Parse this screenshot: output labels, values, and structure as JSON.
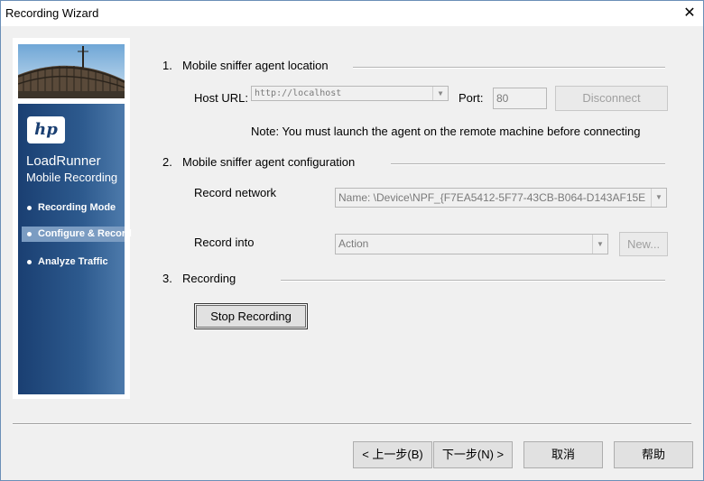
{
  "window": {
    "title": "Recording Wizard",
    "close_glyph": "✕"
  },
  "sidebar": {
    "logo_text": "hp",
    "product": "LoadRunner",
    "subproduct": "Mobile Recording",
    "items": [
      {
        "label": "Recording Mode",
        "active": false
      },
      {
        "label": "Configure & Record",
        "active": true
      },
      {
        "label": "Analyze Traffic",
        "active": false
      }
    ]
  },
  "section1": {
    "number": "1.",
    "title": "Mobile sniffer agent location",
    "host_label": "Host URL:",
    "host_value": "http://localhost",
    "port_label": "Port:",
    "port_value": "80",
    "disconnect_label": "Disconnect",
    "note": "Note: You must launch the agent on the remote machine before connecting"
  },
  "section2": {
    "number": "2.",
    "title": "Mobile sniffer agent configuration",
    "record_network_label": "Record network",
    "record_network_value": "Name: \\Device\\NPF_{F7EA5412-5F77-43CB-B064-D143AF15E",
    "record_into_label": "Record into",
    "record_into_value": "Action",
    "new_label": "New..."
  },
  "section3": {
    "number": "3.",
    "title": "Recording",
    "stop_label": "Stop Recording"
  },
  "footer": {
    "back_label": "< 上一步(B)",
    "next_label": "下一步(N) >",
    "cancel_label": "取消",
    "help_label": "帮助"
  }
}
